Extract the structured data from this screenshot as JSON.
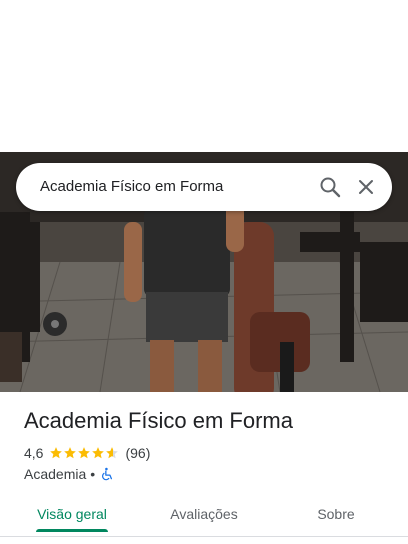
{
  "search": {
    "query": "Academia Físico em Forma",
    "search_icon": "search-icon",
    "close_icon": "close-icon"
  },
  "place": {
    "name": "Academia Físico em Forma",
    "rating": "4,6",
    "stars_filled": 4.6,
    "review_count": "(96)",
    "category": "Academia",
    "separator": "•",
    "accessibility_icon": "wheelchair-icon"
  },
  "tabs": [
    {
      "label": "Visão geral",
      "active": true
    },
    {
      "label": "Avaliações",
      "active": false
    },
    {
      "label": "Sobre",
      "active": false
    }
  ],
  "colors": {
    "accent": "#01875f",
    "star": "#fbbc04",
    "accessibility": "#1a73e8"
  }
}
